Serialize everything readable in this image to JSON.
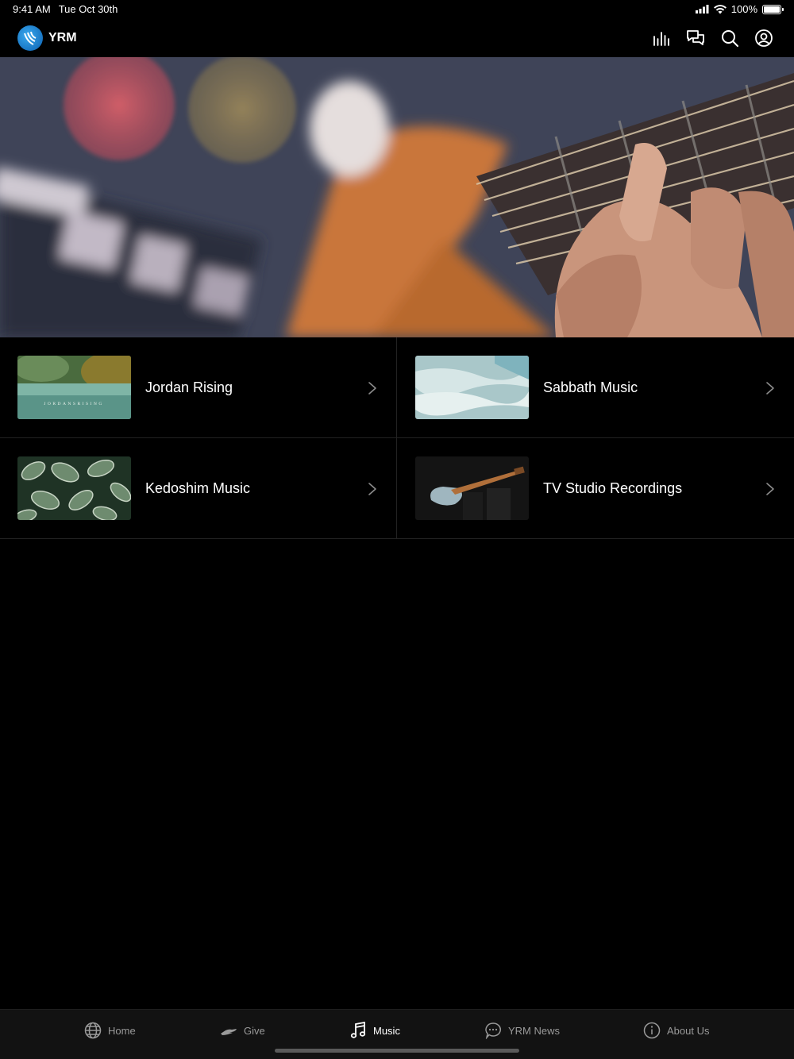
{
  "status": {
    "time": "9:41 AM",
    "date": "Tue Oct 30th",
    "battery": "100%",
    "battery_level": 1.0
  },
  "nav": {
    "title": "YRM",
    "icons": [
      "bar-chart-icon",
      "chat-icon",
      "search-icon",
      "profile-icon"
    ]
  },
  "grid": {
    "items": [
      {
        "label": "Jordan Rising",
        "thumb_text": "JORDANSRISING"
      },
      {
        "label": "Sabbath Music"
      },
      {
        "label": "Kedoshim Music"
      },
      {
        "label": "TV Studio Recordings"
      }
    ]
  },
  "tabs": [
    {
      "label": "Home",
      "icon": "globe-icon"
    },
    {
      "label": "Give",
      "icon": "give-hand-icon"
    },
    {
      "label": "Music",
      "icon": "music-note-icon",
      "active": true
    },
    {
      "label": "YRM News",
      "icon": "message-bubble-icon"
    },
    {
      "label": "About Us",
      "icon": "info-icon"
    }
  ],
  "colors": {
    "background": "#000000",
    "tab_bar": "#121212",
    "inactive_tab": "#9a9a9a",
    "logo": "#1a7fd4"
  }
}
